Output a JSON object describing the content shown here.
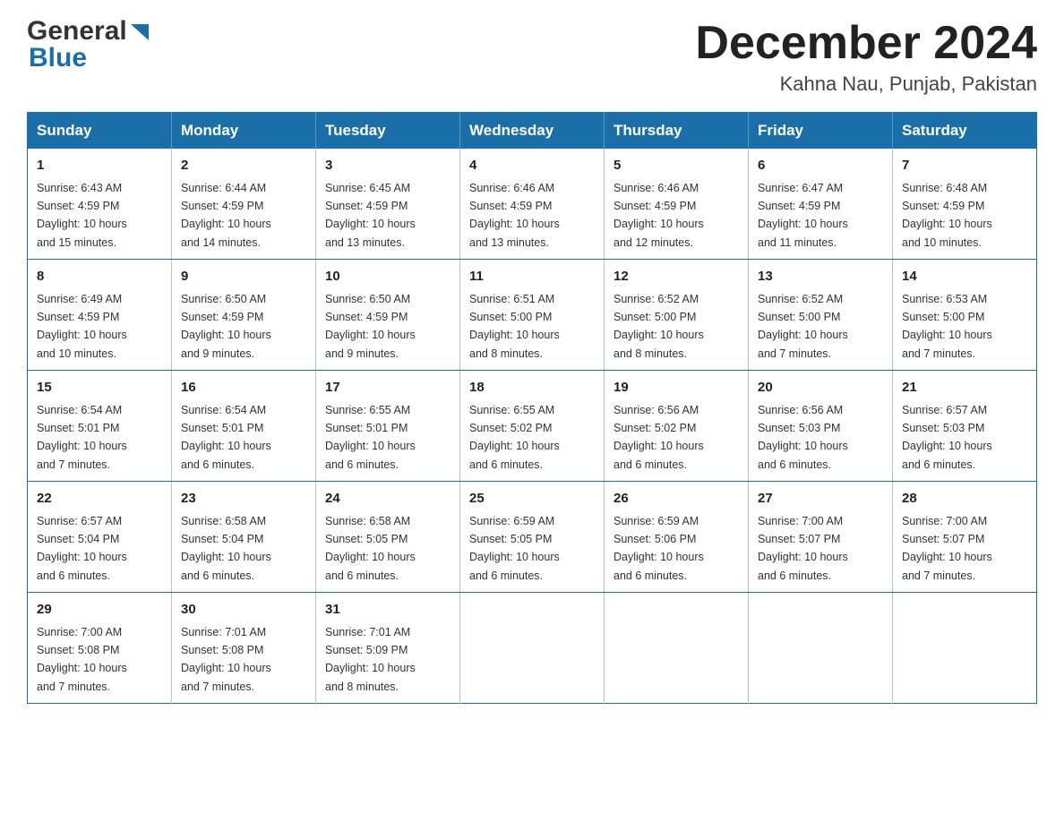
{
  "logo": {
    "general": "General",
    "blue": "Blue"
  },
  "title": {
    "month_year": "December 2024",
    "location": "Kahna Nau, Punjab, Pakistan"
  },
  "headers": [
    "Sunday",
    "Monday",
    "Tuesday",
    "Wednesday",
    "Thursday",
    "Friday",
    "Saturday"
  ],
  "weeks": [
    [
      {
        "day": "1",
        "sunrise": "6:43 AM",
        "sunset": "4:59 PM",
        "daylight": "10 hours and 15 minutes."
      },
      {
        "day": "2",
        "sunrise": "6:44 AM",
        "sunset": "4:59 PM",
        "daylight": "10 hours and 14 minutes."
      },
      {
        "day": "3",
        "sunrise": "6:45 AM",
        "sunset": "4:59 PM",
        "daylight": "10 hours and 13 minutes."
      },
      {
        "day": "4",
        "sunrise": "6:46 AM",
        "sunset": "4:59 PM",
        "daylight": "10 hours and 13 minutes."
      },
      {
        "day": "5",
        "sunrise": "6:46 AM",
        "sunset": "4:59 PM",
        "daylight": "10 hours and 12 minutes."
      },
      {
        "day": "6",
        "sunrise": "6:47 AM",
        "sunset": "4:59 PM",
        "daylight": "10 hours and 11 minutes."
      },
      {
        "day": "7",
        "sunrise": "6:48 AM",
        "sunset": "4:59 PM",
        "daylight": "10 hours and 10 minutes."
      }
    ],
    [
      {
        "day": "8",
        "sunrise": "6:49 AM",
        "sunset": "4:59 PM",
        "daylight": "10 hours and 10 minutes."
      },
      {
        "day": "9",
        "sunrise": "6:50 AM",
        "sunset": "4:59 PM",
        "daylight": "10 hours and 9 minutes."
      },
      {
        "day": "10",
        "sunrise": "6:50 AM",
        "sunset": "4:59 PM",
        "daylight": "10 hours and 9 minutes."
      },
      {
        "day": "11",
        "sunrise": "6:51 AM",
        "sunset": "5:00 PM",
        "daylight": "10 hours and 8 minutes."
      },
      {
        "day": "12",
        "sunrise": "6:52 AM",
        "sunset": "5:00 PM",
        "daylight": "10 hours and 8 minutes."
      },
      {
        "day": "13",
        "sunrise": "6:52 AM",
        "sunset": "5:00 PM",
        "daylight": "10 hours and 7 minutes."
      },
      {
        "day": "14",
        "sunrise": "6:53 AM",
        "sunset": "5:00 PM",
        "daylight": "10 hours and 7 minutes."
      }
    ],
    [
      {
        "day": "15",
        "sunrise": "6:54 AM",
        "sunset": "5:01 PM",
        "daylight": "10 hours and 7 minutes."
      },
      {
        "day": "16",
        "sunrise": "6:54 AM",
        "sunset": "5:01 PM",
        "daylight": "10 hours and 6 minutes."
      },
      {
        "day": "17",
        "sunrise": "6:55 AM",
        "sunset": "5:01 PM",
        "daylight": "10 hours and 6 minutes."
      },
      {
        "day": "18",
        "sunrise": "6:55 AM",
        "sunset": "5:02 PM",
        "daylight": "10 hours and 6 minutes."
      },
      {
        "day": "19",
        "sunrise": "6:56 AM",
        "sunset": "5:02 PM",
        "daylight": "10 hours and 6 minutes."
      },
      {
        "day": "20",
        "sunrise": "6:56 AM",
        "sunset": "5:03 PM",
        "daylight": "10 hours and 6 minutes."
      },
      {
        "day": "21",
        "sunrise": "6:57 AM",
        "sunset": "5:03 PM",
        "daylight": "10 hours and 6 minutes."
      }
    ],
    [
      {
        "day": "22",
        "sunrise": "6:57 AM",
        "sunset": "5:04 PM",
        "daylight": "10 hours and 6 minutes."
      },
      {
        "day": "23",
        "sunrise": "6:58 AM",
        "sunset": "5:04 PM",
        "daylight": "10 hours and 6 minutes."
      },
      {
        "day": "24",
        "sunrise": "6:58 AM",
        "sunset": "5:05 PM",
        "daylight": "10 hours and 6 minutes."
      },
      {
        "day": "25",
        "sunrise": "6:59 AM",
        "sunset": "5:05 PM",
        "daylight": "10 hours and 6 minutes."
      },
      {
        "day": "26",
        "sunrise": "6:59 AM",
        "sunset": "5:06 PM",
        "daylight": "10 hours and 6 minutes."
      },
      {
        "day": "27",
        "sunrise": "7:00 AM",
        "sunset": "5:07 PM",
        "daylight": "10 hours and 6 minutes."
      },
      {
        "day": "28",
        "sunrise": "7:00 AM",
        "sunset": "5:07 PM",
        "daylight": "10 hours and 7 minutes."
      }
    ],
    [
      {
        "day": "29",
        "sunrise": "7:00 AM",
        "sunset": "5:08 PM",
        "daylight": "10 hours and 7 minutes."
      },
      {
        "day": "30",
        "sunrise": "7:01 AM",
        "sunset": "5:08 PM",
        "daylight": "10 hours and 7 minutes."
      },
      {
        "day": "31",
        "sunrise": "7:01 AM",
        "sunset": "5:09 PM",
        "daylight": "10 hours and 8 minutes."
      },
      null,
      null,
      null,
      null
    ]
  ],
  "labels": {
    "sunrise": "Sunrise:",
    "sunset": "Sunset:",
    "daylight": "Daylight:"
  }
}
